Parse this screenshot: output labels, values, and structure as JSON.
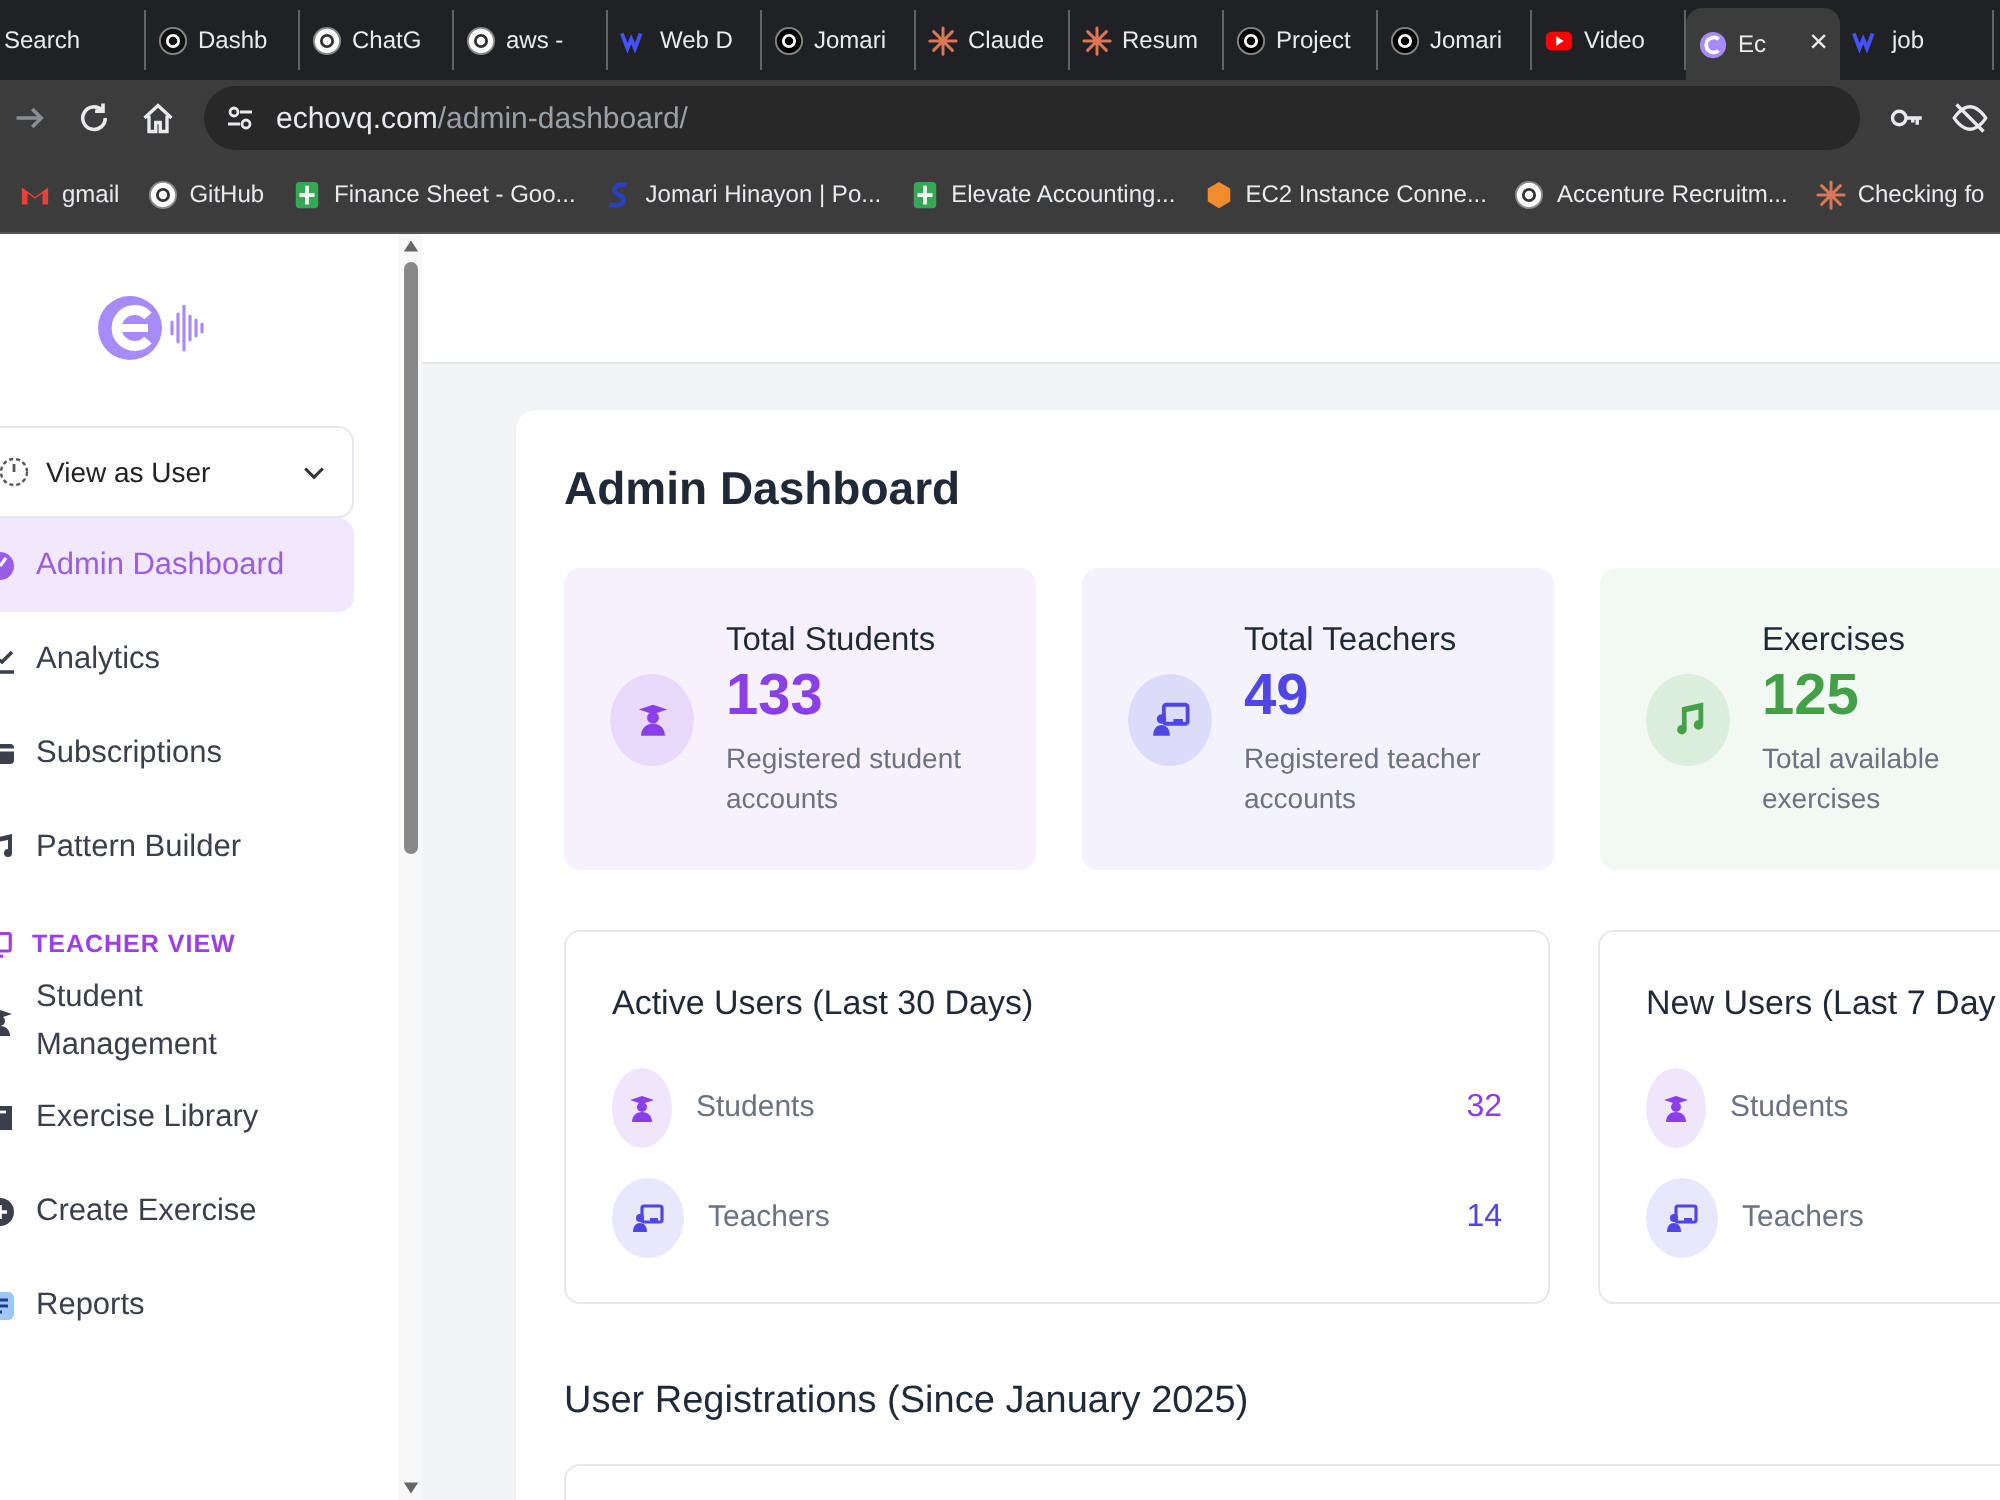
{
  "browser": {
    "tabs": [
      {
        "label": "Search",
        "kind": "none",
        "selected": false
      },
      {
        "label": "Dashb",
        "kind": "tiktok",
        "selected": false
      },
      {
        "label": "ChatG",
        "kind": "openai",
        "selected": false
      },
      {
        "label": "aws -",
        "kind": "google",
        "selected": false
      },
      {
        "label": "Web D",
        "kind": "webflow",
        "selected": false
      },
      {
        "label": "Jomari",
        "kind": "upwork",
        "selected": false
      },
      {
        "label": "Claude",
        "kind": "claude",
        "selected": false
      },
      {
        "label": "Resum",
        "kind": "claude",
        "selected": false
      },
      {
        "label": "Project",
        "kind": "upwork",
        "selected": false
      },
      {
        "label": "Jomari",
        "kind": "upwork",
        "selected": false
      },
      {
        "label": "Video",
        "kind": "youtube",
        "selected": false
      },
      {
        "label": "Ec",
        "kind": "echo",
        "selected": true
      },
      {
        "label": "job",
        "kind": "webflow",
        "selected": false
      }
    ],
    "close_label": "×",
    "url_host": "echovq.com",
    "url_path": "/admin-dashboard/",
    "bookmarks": [
      {
        "label": "gmail",
        "kind": "gmail"
      },
      {
        "label": "GitHub",
        "kind": "github"
      },
      {
        "label": "Finance Sheet - Goo...",
        "kind": "sheets"
      },
      {
        "label": "Jomari Hinayon | Po...",
        "kind": "portfolio"
      },
      {
        "label": "Elevate Accounting...",
        "kind": "sheets"
      },
      {
        "label": "EC2 Instance Conne...",
        "kind": "aws"
      },
      {
        "label": "Accenture Recruitm...",
        "kind": "openai"
      },
      {
        "label": "Checking fo",
        "kind": "claude"
      }
    ]
  },
  "sidebar": {
    "view_select": {
      "value": "View as User"
    },
    "items": [
      {
        "kind": "item",
        "label": "Admin Dashboard",
        "selected": true
      },
      {
        "kind": "item",
        "label": "Analytics",
        "selected": false
      },
      {
        "kind": "item",
        "label": "Subscriptions",
        "selected": false
      },
      {
        "kind": "item",
        "label": "Pattern Builder",
        "selected": false
      },
      {
        "kind": "header",
        "label": "TEACHER VIEW"
      },
      {
        "kind": "item",
        "label": "Student Management",
        "selected": false
      },
      {
        "kind": "item",
        "label": "Exercise Library",
        "selected": false
      },
      {
        "kind": "item",
        "label": "Create Exercise",
        "selected": false
      },
      {
        "kind": "item",
        "label": "Reports",
        "selected": false
      }
    ]
  },
  "page": {
    "title": "Admin Dashboard",
    "stats": [
      {
        "title": "Total Students",
        "value": "133",
        "caption": "Registered student accounts",
        "kind": "student",
        "color": "#8b3fe8"
      },
      {
        "title": "Total Teachers",
        "value": "49",
        "caption": "Registered teacher accounts",
        "kind": "teacher",
        "color": "#4f46e5"
      },
      {
        "title": "Exercises",
        "value": "125",
        "caption": "Total available exercises",
        "kind": "music",
        "color": "#43a047"
      }
    ],
    "panels": [
      {
        "title": "Active Users (Last 30 Days)",
        "rows": [
          {
            "label": "Students",
            "value": "32",
            "kind": "student",
            "color": "#8b3fe8"
          },
          {
            "label": "Teachers",
            "value": "14",
            "kind": "teacher",
            "color": "#4f46e5"
          }
        ]
      },
      {
        "title": "New Users (Last 7 Day",
        "rows": [
          {
            "label": "Students",
            "kind": "student",
            "color": "#8b3fe8"
          },
          {
            "label": "Teachers",
            "kind": "teacher",
            "color": "#4f46e5"
          }
        ]
      }
    ],
    "section_title": "User Registrations (Since January 2025)"
  }
}
